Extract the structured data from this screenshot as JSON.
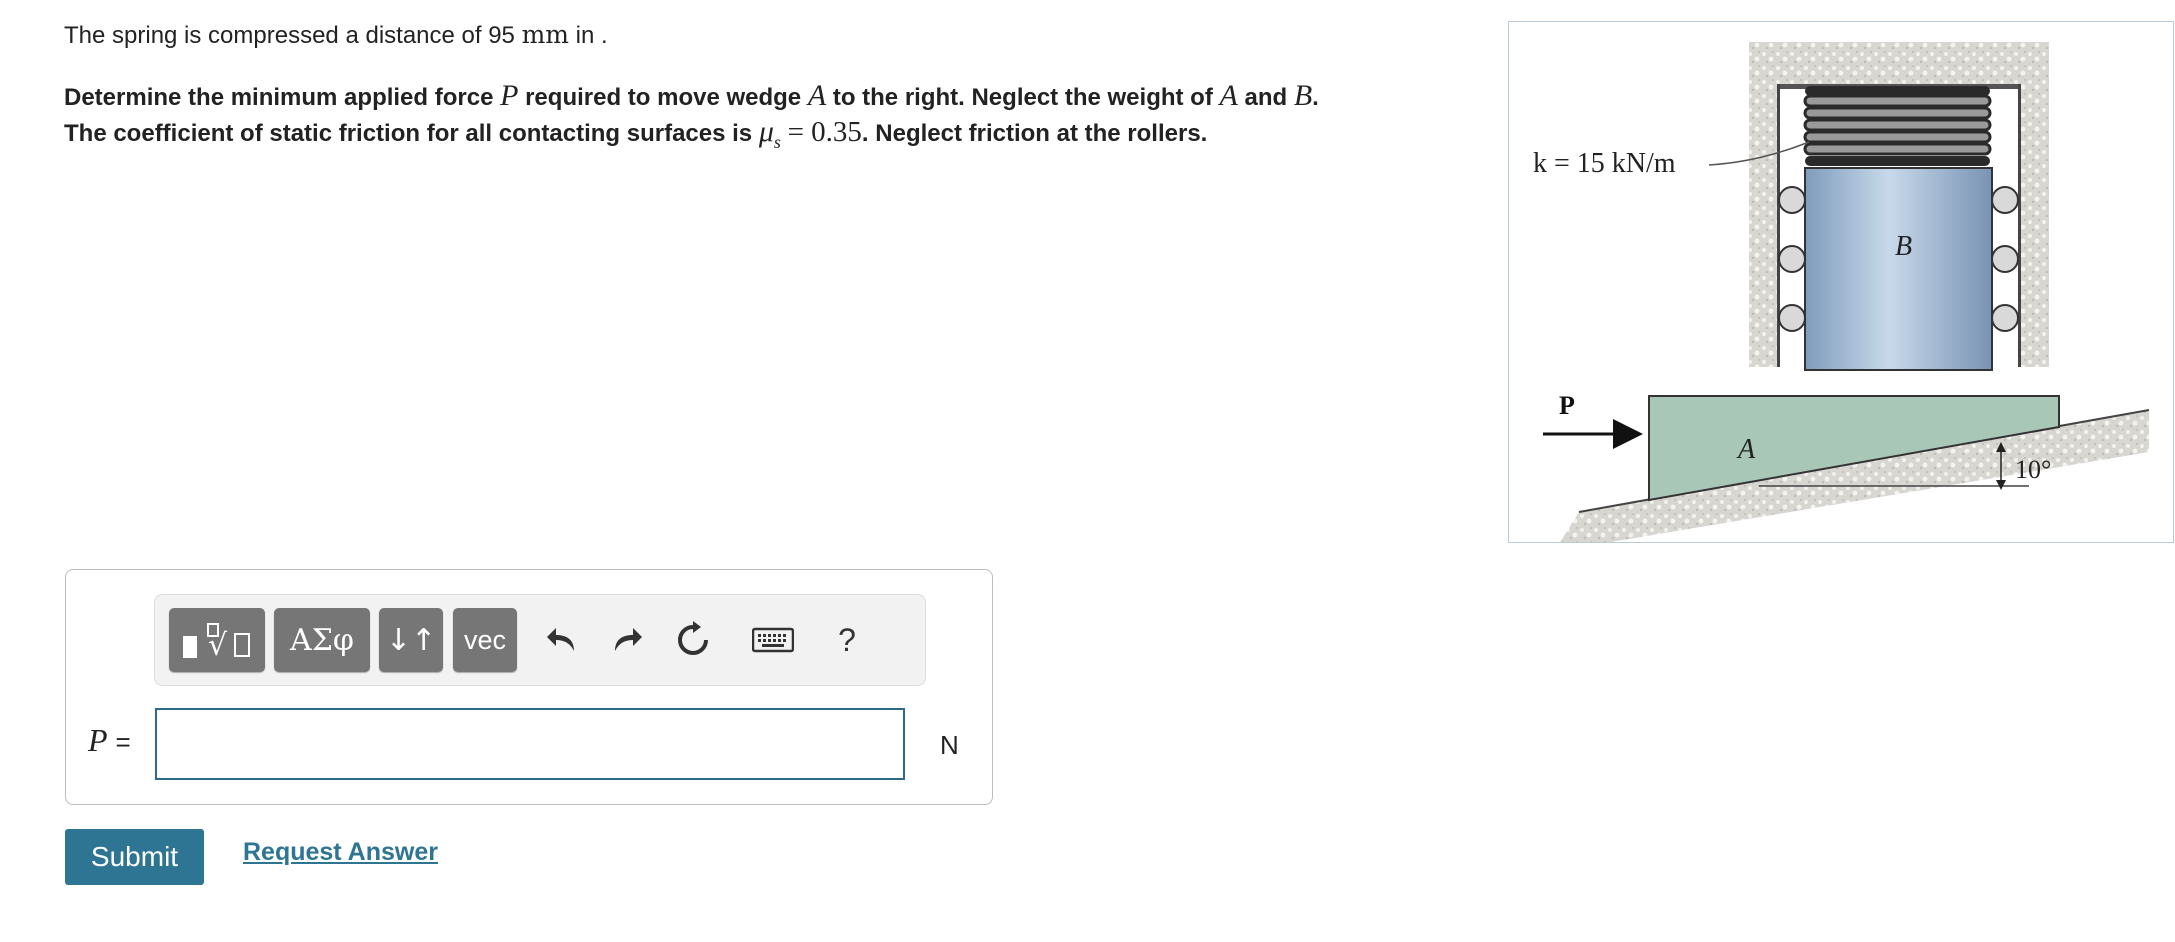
{
  "problem": {
    "intro_prefix": "The spring is compressed a distance of 95",
    "intro_unit": "mm",
    "intro_suffix": "in .",
    "s1": "Determine the minimum applied force",
    "var_P": "P",
    "s2": "required to move wedge",
    "var_A": "A",
    "s3": "to the right. Neglect the weight of",
    "var_A2": "A",
    "s4": "and",
    "var_B": "B",
    "s5": ".",
    "s6": "The coefficient of static friction for all contacting surfaces is",
    "mu": "μ",
    "mu_sub": "s",
    "mu_eq": "= 0.35",
    "s7": ". Neglect friction at the rollers."
  },
  "figure": {
    "spring_label": "k = 15 kN/m",
    "label_B": "B",
    "label_A": "A",
    "label_P": "P",
    "angle_label": "10°"
  },
  "toolbar": {
    "templates_label": "√",
    "greek_label": "ΑΣφ",
    "arrows_label": "↓↑",
    "vec_label": "vec",
    "undo_icon": "undo-icon",
    "redo_icon": "redo-icon",
    "reset_icon": "reset-icon",
    "keyboard_icon": "keyboard-icon",
    "help_label": "?"
  },
  "answer": {
    "variable": "P",
    "equals": "=",
    "value": "",
    "unit": "N"
  },
  "actions": {
    "submit_label": "Submit",
    "request_label": "Request Answer"
  },
  "colors": {
    "accent": "#2e7493",
    "toolbar_button": "#767676",
    "wedge": "#a9c7b7",
    "block": "#a7c1da"
  }
}
